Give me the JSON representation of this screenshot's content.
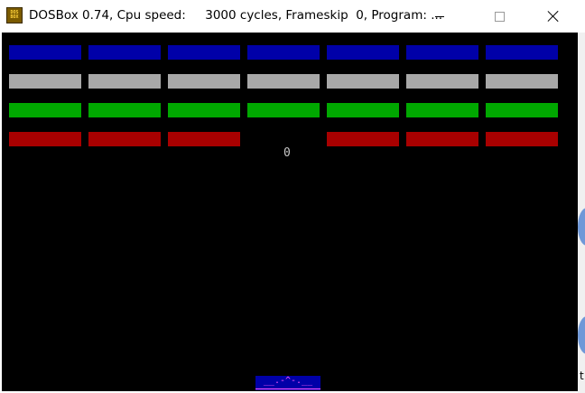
{
  "window": {
    "title": "DOSBox 0.74, Cpu speed:     3000 cycles, Frameskip  0, Program: ...",
    "icon": "dosbox-icon",
    "icon_text_top": "DOS",
    "icon_text_bottom": "BOX"
  },
  "controls": {
    "minimize": "minimize-icon",
    "maximize": "maximize-icon",
    "close": "close-icon"
  },
  "game": {
    "score": "0",
    "paddle_text": "__.-^-.__",
    "brick_rows": [
      {
        "color": "#0000a8",
        "present": [
          true,
          true,
          true,
          true,
          true,
          true,
          true
        ]
      },
      {
        "color": "#a8a8a8",
        "present": [
          true,
          true,
          true,
          true,
          true,
          true,
          true
        ]
      },
      {
        "color": "#00a800",
        "present": [
          true,
          true,
          true,
          true,
          true,
          true,
          true
        ]
      },
      {
        "color": "#a80000",
        "present": [
          true,
          true,
          true,
          false,
          true,
          true,
          true
        ]
      }
    ]
  },
  "background": {
    "edge_letter": "t"
  }
}
